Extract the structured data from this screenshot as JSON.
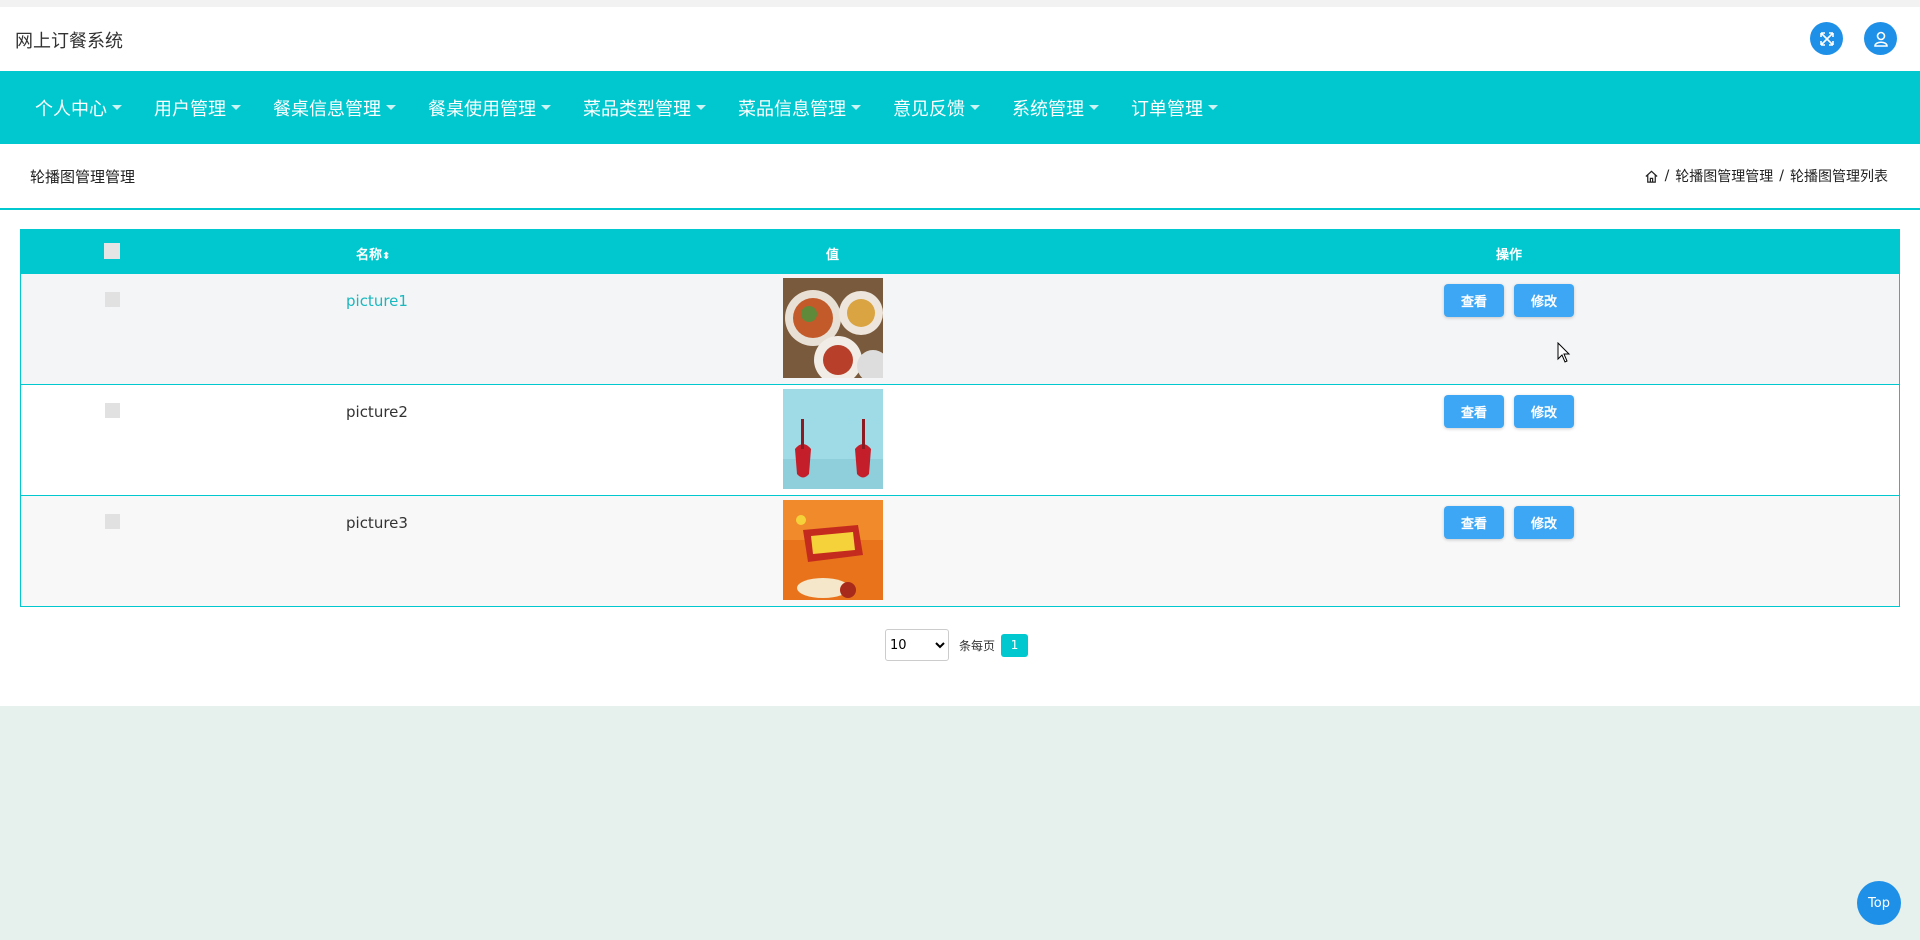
{
  "header": {
    "app_title": "网上订餐系统",
    "fullscreen_icon": "fullscreen-icon",
    "user_icon": "user-icon"
  },
  "nav": {
    "items": [
      {
        "label": "个人中心"
      },
      {
        "label": "用户管理"
      },
      {
        "label": "餐桌信息管理"
      },
      {
        "label": "餐桌使用管理"
      },
      {
        "label": "菜品类型管理"
      },
      {
        "label": "菜品信息管理"
      },
      {
        "label": "意见反馈"
      },
      {
        "label": "系统管理"
      },
      {
        "label": "订单管理"
      }
    ]
  },
  "page": {
    "title": "轮播图管理管理",
    "breadcrumb": [
      "轮播图管理管理",
      "轮播图管理列表"
    ]
  },
  "table": {
    "columns": {
      "name": "名称",
      "value": "值",
      "actions": "操作"
    },
    "rows": [
      {
        "name": "picture1",
        "image": "food-dishes"
      },
      {
        "name": "picture2",
        "image": "drinks-on-blue"
      },
      {
        "name": "picture3",
        "image": "orange-food-banner"
      }
    ],
    "view_label": "查看",
    "edit_label": "修改"
  },
  "pagination": {
    "page_size": "10",
    "page_size_options": [
      "10"
    ],
    "per_page_label": "条每页",
    "current_page": "1"
  },
  "back_to_top": "Top",
  "colors": {
    "accent": "#00c8ce",
    "button": "#3ea7f5",
    "icon_button": "#1e90e8",
    "background": "#e6f0ec"
  }
}
